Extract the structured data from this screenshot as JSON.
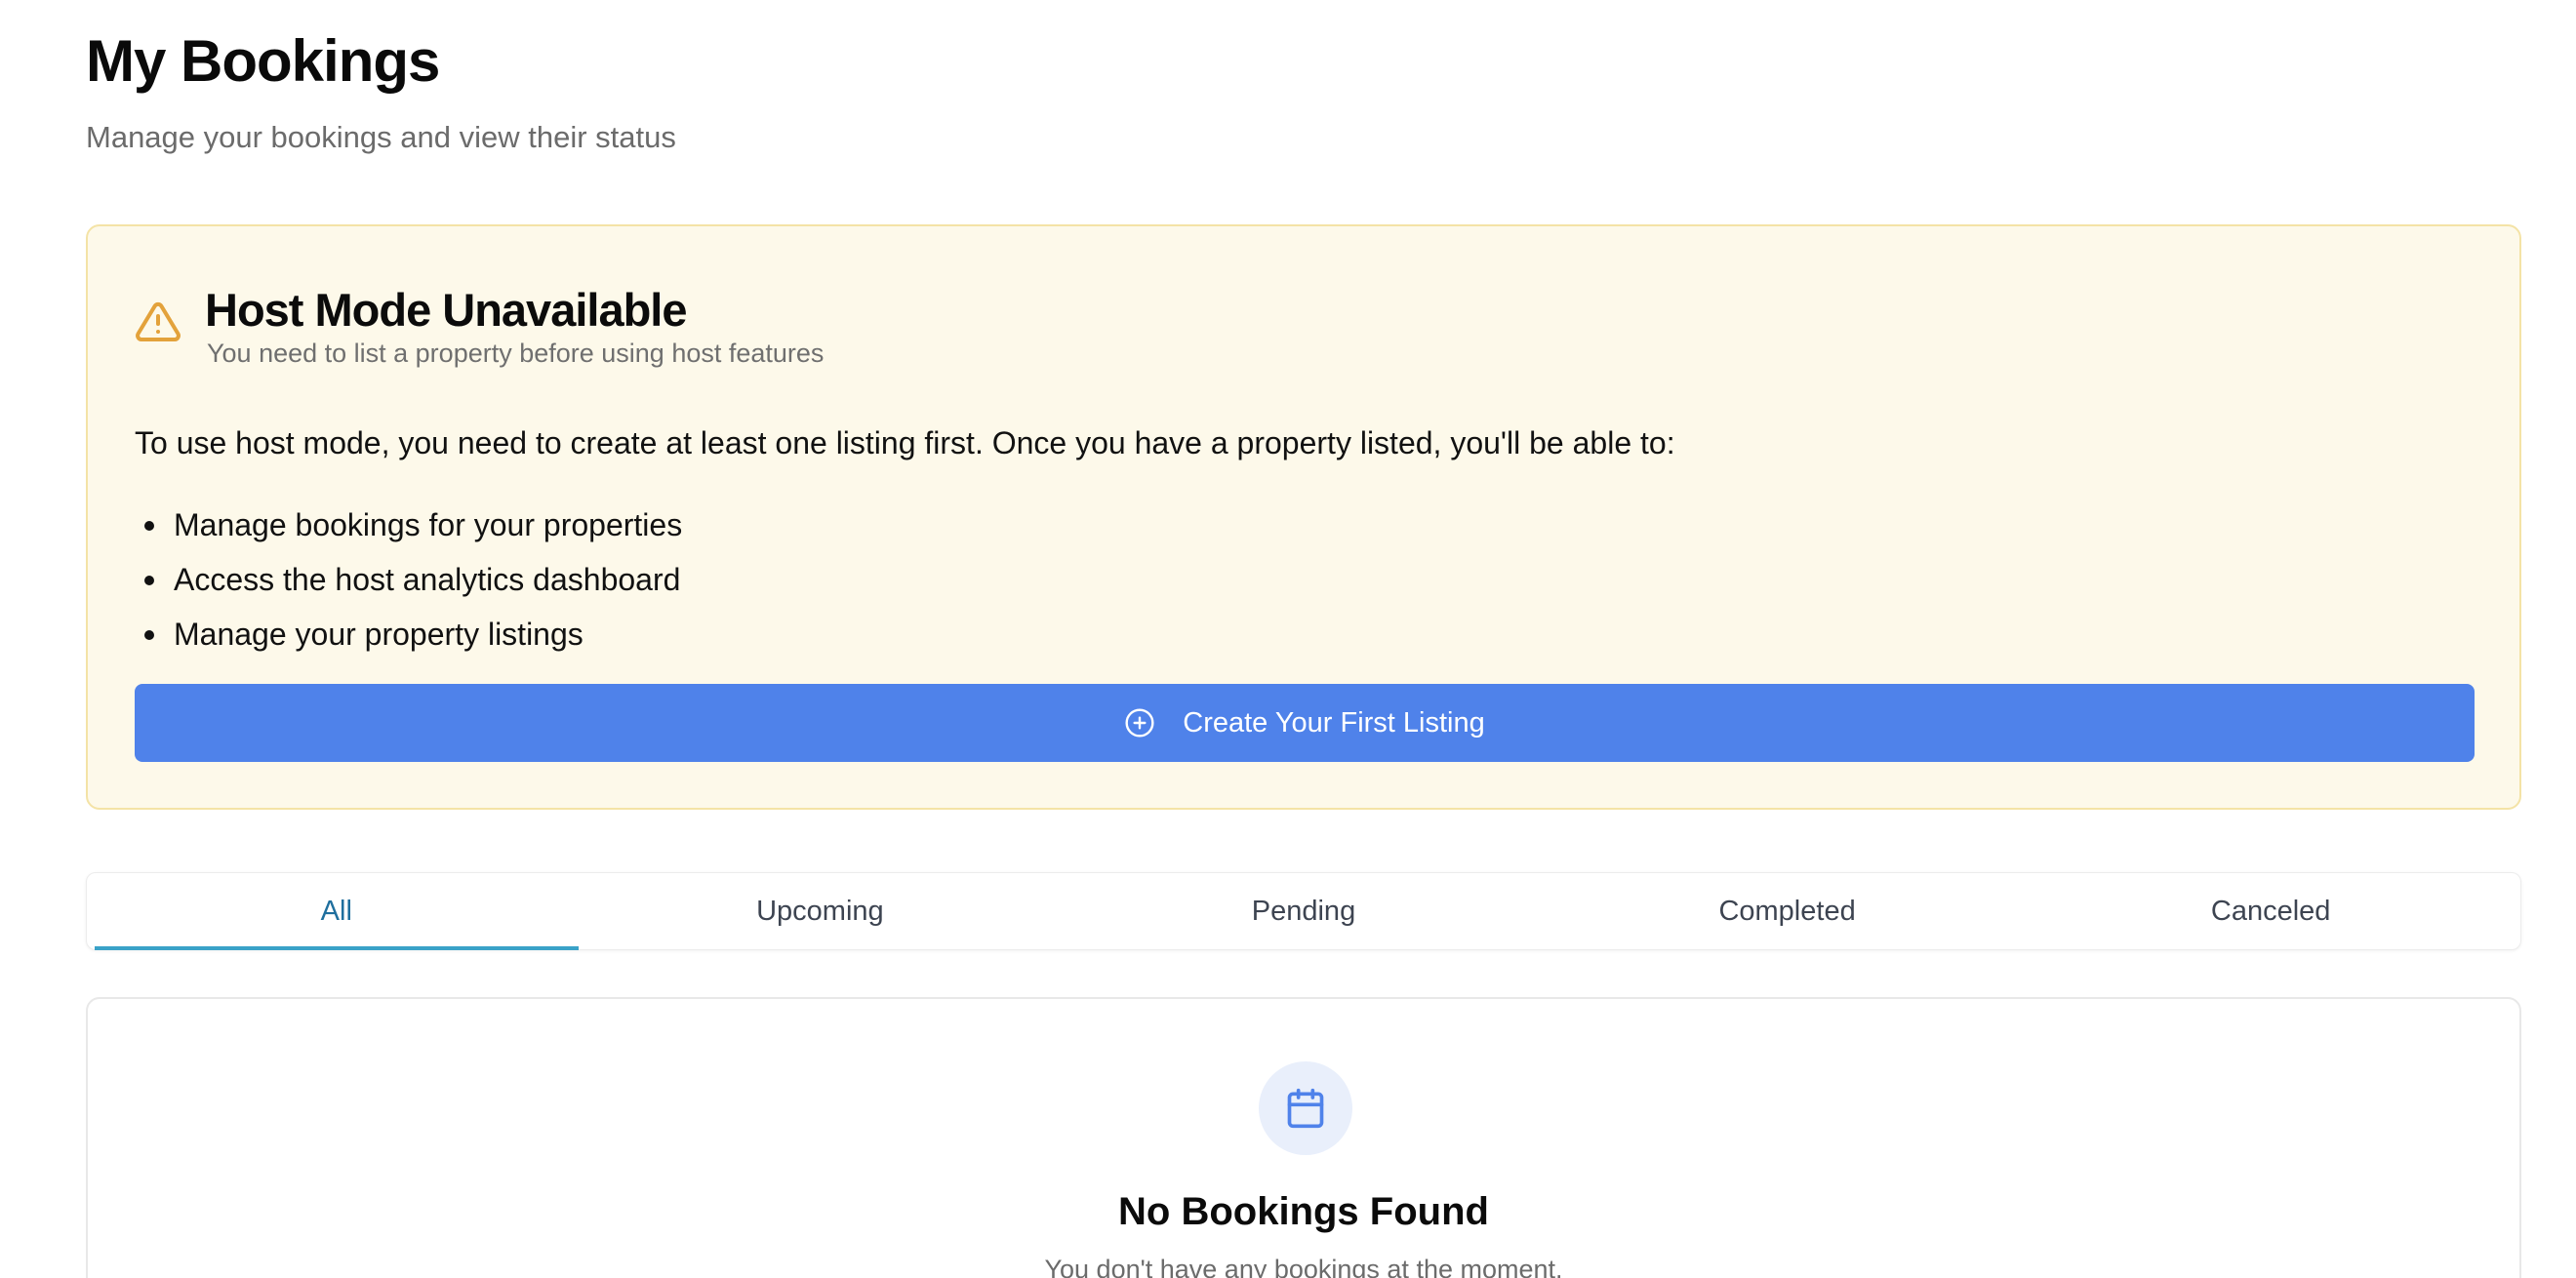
{
  "header": {
    "title": "My Bookings",
    "subtitle": "Manage your bookings and view their status"
  },
  "host_alert": {
    "icon": "warning-triangle-icon",
    "title": "Host Mode Unavailable",
    "subtitle": "You need to list a property before using host features",
    "body": "To use host mode, you need to create at least one listing first. Once you have a property listed, you'll be able to:",
    "features": [
      "Manage bookings for your properties",
      "Access the host analytics dashboard",
      "Manage your property listings"
    ],
    "button_icon": "plus-circle-icon",
    "button_label": "Create Your First Listing",
    "colors": {
      "background": "#fdf9ea",
      "border": "#f4e3a6",
      "icon": "#e3a23b",
      "button": "#4f82ea"
    }
  },
  "tabs": [
    {
      "label": "All",
      "active": true
    },
    {
      "label": "Upcoming",
      "active": false
    },
    {
      "label": "Pending",
      "active": false
    },
    {
      "label": "Completed",
      "active": false
    },
    {
      "label": "Canceled",
      "active": false
    }
  ],
  "empty_state": {
    "icon": "calendar-icon",
    "title": "No Bookings Found",
    "subtitle": "You don't have any bookings at the moment."
  }
}
